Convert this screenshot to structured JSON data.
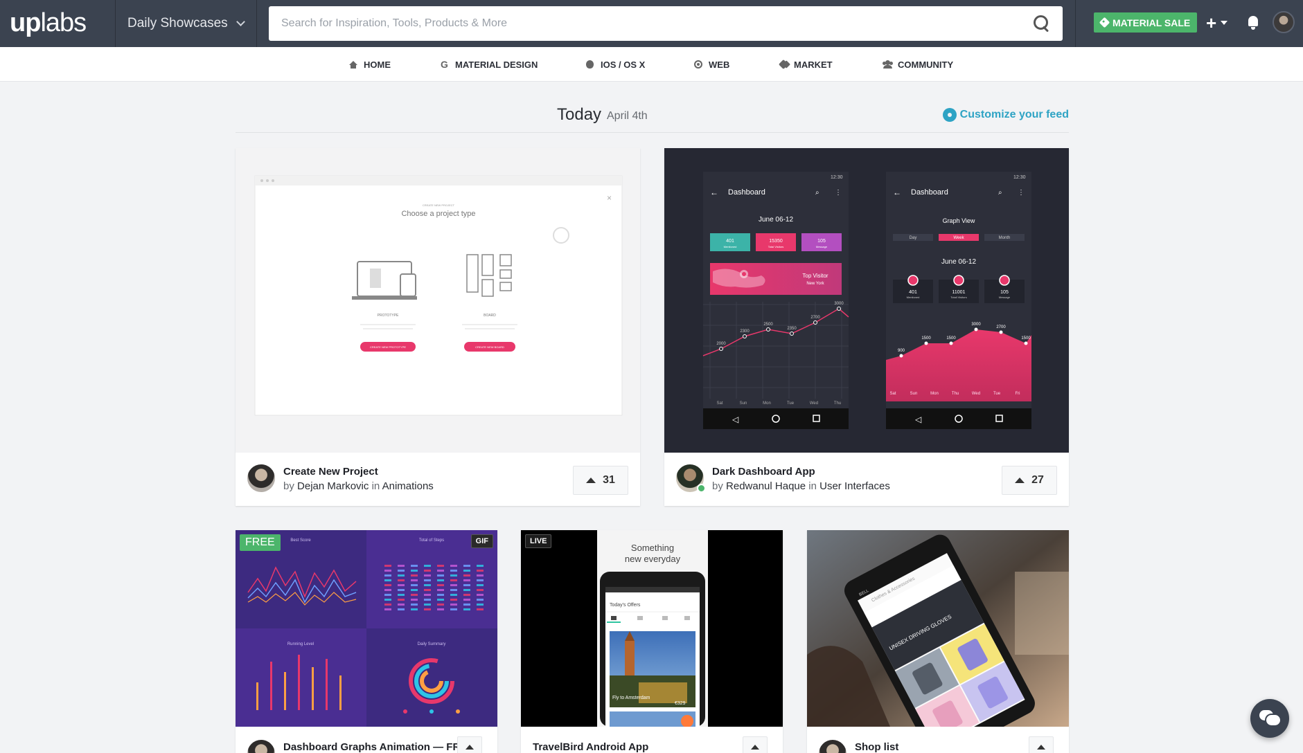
{
  "brand": {
    "logo_u": "up",
    "logo_rest": "labs"
  },
  "topbar": {
    "showcase_label": "Daily Showcases",
    "search_placeholder": "Search for Inspiration, Tools, Products & More",
    "sale_label": "MATERIAL SALE",
    "plus_label": "+"
  },
  "nav": {
    "items": [
      {
        "label": "HOME",
        "icon": "home-icon"
      },
      {
        "label": "MATERIAL DESIGN",
        "icon": "google-icon"
      },
      {
        "label": "IOS / OS X",
        "icon": "apple-icon"
      },
      {
        "label": "WEB",
        "icon": "globe-icon"
      },
      {
        "label": "MARKET",
        "icon": "tags-icon"
      },
      {
        "label": "COMMUNITY",
        "icon": "users-icon"
      }
    ],
    "google_glyph": "G"
  },
  "section": {
    "title": "Today",
    "date": "April 4th",
    "customize": "Customize your feed"
  },
  "cards_large": [
    {
      "title": "Create New Project",
      "by": "by",
      "author": "Dejan Markovic",
      "in": "in",
      "category": "Animations",
      "votes": "31",
      "mock": {
        "small_header": "CREATE NEW PROJECT",
        "heading": "Choose a project type",
        "opt1": "PROTOTYPE",
        "opt2": "BOARD",
        "btn1": "CREATE NEW PROTOTYPE",
        "btn2": "CREATE NEW BOARD",
        "close": "×"
      }
    },
    {
      "title": "Dark Dashboard App",
      "by": "by",
      "author": "Redwanul Haque",
      "in": "in",
      "category": "User Interfaces",
      "votes": "27",
      "mock": {
        "time": "12:30",
        "app_title": "Dashboard",
        "range": "June 06-12",
        "graph_view": "Graph View",
        "tabs": [
          "Day",
          "Week",
          "Month"
        ],
        "stats": [
          {
            "value": "401",
            "label": "Mentioned"
          },
          {
            "value": "15350",
            "label": "Total Visitors"
          },
          {
            "value": "105",
            "label": "Message"
          }
        ],
        "stats2": [
          {
            "value": "401",
            "label": "Mentioned"
          },
          {
            "value": "11001",
            "label": "Totall Visitors"
          },
          {
            "value": "105",
            "label": "Message"
          }
        ],
        "map_title": "Top Visitor",
        "map_sub": "New York",
        "days": [
          "Sat",
          "Sun",
          "Mon",
          "Tue",
          "Wed",
          "Thu"
        ],
        "days2": [
          "Sat",
          "Sun",
          "Mon",
          "Thu",
          "Wed",
          "Tue",
          "Fri"
        ],
        "line_labels": [
          "2000",
          "2300",
          "2500",
          "2350",
          "2700",
          "3000"
        ],
        "area_labels": [
          "900",
          "1500",
          "1500",
          "3000",
          "2700",
          "1500"
        ]
      }
    }
  ],
  "cards_small": [
    {
      "title": "Dashboard Graphs Animation — FR...",
      "badge_left": "FREE",
      "badge_right": "GIF",
      "mock": {
        "q1": "Best Score",
        "q2": "Total of Steps",
        "q3": "Running Level",
        "q4": "Daily Summary"
      }
    },
    {
      "title": "TravelBird Android App",
      "badge_left": "LIVE",
      "mock": {
        "headline": "Something new everyday",
        "offers": "Today's Offers",
        "fly": "Fly to Amsterdam",
        "price": "€329"
      }
    },
    {
      "title": "Shop list",
      "mock": {
        "status": "BELL",
        "crumb": "Clothes & Accessories",
        "overlay": "UNISEX DRIVING GLOVES"
      }
    }
  ],
  "colors": {
    "topbar": "#3b4350",
    "accent": "#2ea3c4",
    "sale": "#4cb56b",
    "pink": "#e8386b",
    "purple": "#4a2a8a"
  }
}
